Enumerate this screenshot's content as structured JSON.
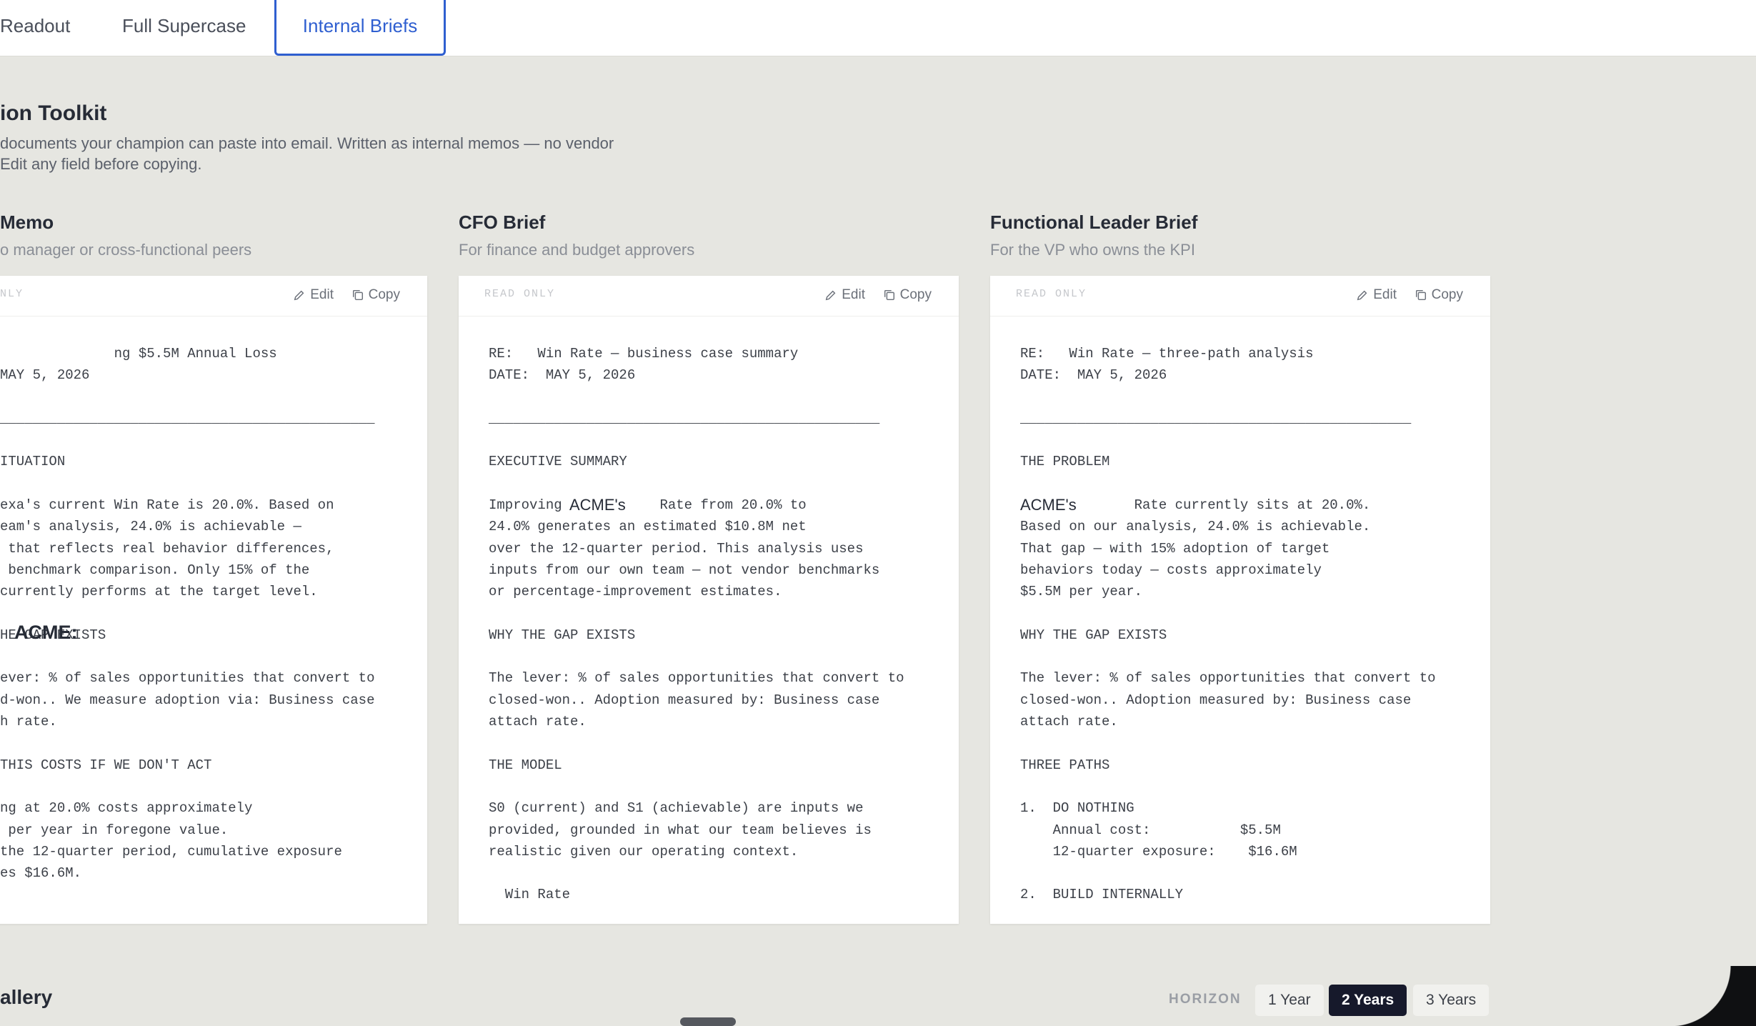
{
  "tabs": [
    "Readout",
    "Full Supercase",
    "Internal Briefs"
  ],
  "section": {
    "title": "ion Toolkit",
    "description": "documents your champion can paste into email. Written as internal memos — no vendor\n Edit any field before copying."
  },
  "cards": [
    {
      "title": "Memo",
      "subtitle": "o manager or cross-functional peers",
      "readonly_label": "NLY",
      "edit_label": "Edit",
      "copy_label": "Copy",
      "overlay": "ACME:",
      "body": "              ng $5.5M Annual Loss\nMAY 5, 2026\n\n______________________________________________\n\nITUATION\n\nexa's current Win Rate is 20.0%. Based on\neam's analysis, 24.0% is achievable —\n that reflects real behavior differences,\n benchmark comparison. Only 15% of the\ncurrently performs at the target level.\n\nHE GAP EXISTS\n\never: % of sales opportunities that convert to\nd-won.. We measure adoption via: Business case\nh rate.\n\nTHIS COSTS IF WE DON'T ACT\n\nng at 20.0% costs approximately\n per year in foregone value.\nthe 12-quarter period, cumulative exposure\nes $16.6M."
    },
    {
      "title": "CFO Brief",
      "subtitle": "For finance and budget approvers",
      "readonly_label": "READ ONLY",
      "edit_label": "Edit",
      "copy_label": "Copy",
      "overlay": "ACME's",
      "body": "RE:   Win Rate — business case summary\nDATE:  MAY 5, 2026\n\n________________________________________________\n\nEXECUTIVE SUMMARY\n\nImproving            Rate from 20.0% to\n24.0% generates an estimated $10.8M net\nover the 12-quarter period. This analysis uses\ninputs from our own team — not vendor benchmarks\nor percentage-improvement estimates.\n\nWHY THE GAP EXISTS\n\nThe lever: % of sales opportunities that convert to\nclosed-won.. Adoption measured by: Business case\nattach rate.\n\nTHE MODEL\n\nS0 (current) and S1 (achievable) are inputs we\nprovided, grounded in what our team believes is\nrealistic given our operating context.\n\n  Win Rate"
    },
    {
      "title": "Functional Leader Brief",
      "subtitle": "For the VP who owns the KPI",
      "readonly_label": "READ ONLY",
      "edit_label": "Edit",
      "copy_label": "Copy",
      "overlay": "ACME's",
      "body": "RE:   Win Rate — three-path analysis\nDATE:  MAY 5, 2026\n\n________________________________________________\n\nTHE PROBLEM\n\n              Rate currently sits at 20.0%.\nBased on our analysis, 24.0% is achievable.\nThat gap — with 15% adoption of target\nbehaviors today — costs approximately\n$5.5M per year.\n\nWHY THE GAP EXISTS\n\nThe lever: % of sales opportunities that convert to\nclosed-won.. Adoption measured by: Business case\nattach rate.\n\nTHREE PATHS\n\n1.  DO NOTHING\n    Annual cost:           $5.5M\n    12-quarter exposure:    $16.6M\n\n2.  BUILD INTERNALLY"
    }
  ],
  "footer": {
    "gallery_title": "allery",
    "horizon_label": "HORIZON",
    "horizon_options": [
      "1 Year",
      "2 Years",
      "3 Years"
    ],
    "horizon_selected": "2 Years"
  },
  "colors": {
    "accent": "#2f5fd0",
    "page_bg": "#e6e6e1",
    "selected_pill": "#16192b"
  }
}
